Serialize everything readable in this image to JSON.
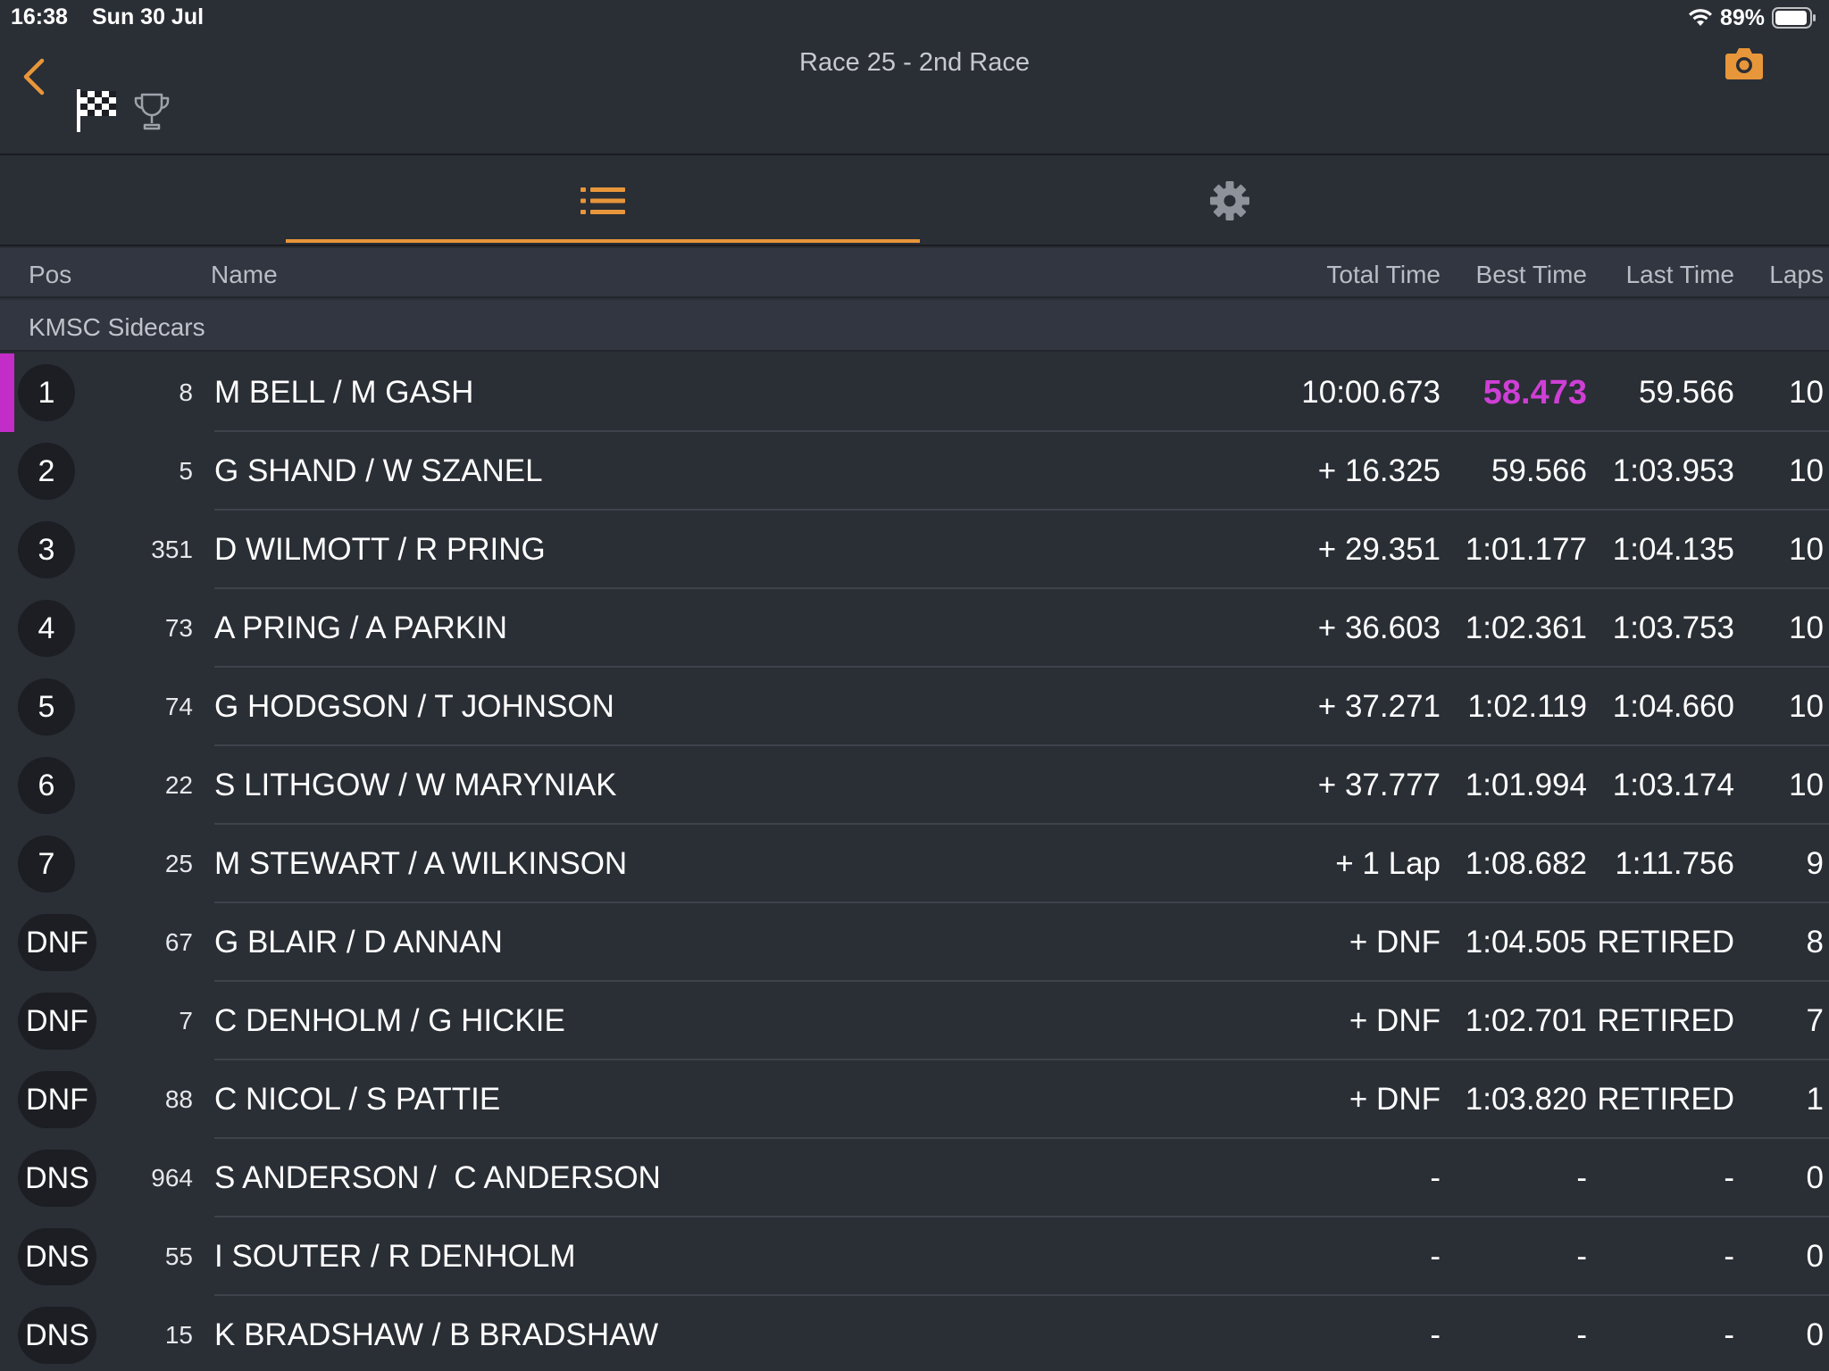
{
  "status_bar": {
    "time": "16:38",
    "date": "Sun 30 Jul",
    "battery": "89%"
  },
  "header": {
    "title": "Race 25 - 2nd Race"
  },
  "colors": {
    "accent": "#e8963a",
    "leader_highlight": "#c22dc7",
    "background": "#2a2e35"
  },
  "icons": {
    "back": "chevron-left-icon",
    "flag": "checkered-flag-icon",
    "trophy": "trophy-icon",
    "camera": "camera-icon",
    "results_tab": "list-icon",
    "settings_tab": "gear-icon"
  },
  "table": {
    "headers": {
      "pos": "Pos",
      "name": "Name",
      "total": "Total Time",
      "best": "Best Time",
      "last": "Last Time",
      "laps": "Laps"
    },
    "group": "KMSC Sidecars",
    "rows": [
      {
        "pos": "1",
        "num": "8",
        "name": "M BELL / M GASH",
        "total": "10:00.673",
        "best": "58.473",
        "last": "59.566",
        "laps": "10"
      },
      {
        "pos": "2",
        "num": "5",
        "name": "G SHAND / W SZANEL",
        "total": "+ 16.325",
        "best": "59.566",
        "last": "1:03.953",
        "laps": "10"
      },
      {
        "pos": "3",
        "num": "351",
        "name": "D WILMOTT / R PRING",
        "total": "+ 29.351",
        "best": "1:01.177",
        "last": "1:04.135",
        "laps": "10"
      },
      {
        "pos": "4",
        "num": "73",
        "name": "A PRING / A PARKIN",
        "total": "+ 36.603",
        "best": "1:02.361",
        "last": "1:03.753",
        "laps": "10"
      },
      {
        "pos": "5",
        "num": "74",
        "name": "G HODGSON / T JOHNSON",
        "total": "+ 37.271",
        "best": "1:02.119",
        "last": "1:04.660",
        "laps": "10"
      },
      {
        "pos": "6",
        "num": "22",
        "name": "S LITHGOW / W MARYNIAK",
        "total": "+ 37.777",
        "best": "1:01.994",
        "last": "1:03.174",
        "laps": "10"
      },
      {
        "pos": "7",
        "num": "25",
        "name": "M STEWART / A WILKINSON",
        "total": "+ 1 Lap",
        "best": "1:08.682",
        "last": "1:11.756",
        "laps": "9"
      },
      {
        "pos": "DNF",
        "num": "67",
        "name": "G BLAIR / D ANNAN",
        "total": "+ DNF",
        "best": "1:04.505",
        "last": "RETIRED",
        "laps": "8"
      },
      {
        "pos": "DNF",
        "num": "7",
        "name": "C DENHOLM / G HICKIE",
        "total": "+ DNF",
        "best": "1:02.701",
        "last": "RETIRED",
        "laps": "7"
      },
      {
        "pos": "DNF",
        "num": "88",
        "name": "C NICOL / S PATTIE",
        "total": "+ DNF",
        "best": "1:03.820",
        "last": "RETIRED",
        "laps": "1"
      },
      {
        "pos": "DNS",
        "num": "964",
        "name": "S ANDERSON /  C ANDERSON",
        "total": "-",
        "best": "-",
        "last": "-",
        "laps": "0"
      },
      {
        "pos": "DNS",
        "num": "55",
        "name": "I SOUTER / R DENHOLM",
        "total": "-",
        "best": "-",
        "last": "-",
        "laps": "0"
      },
      {
        "pos": "DNS",
        "num": "15",
        "name": "K BRADSHAW / B BRADSHAW",
        "total": "-",
        "best": "-",
        "last": "-",
        "laps": "0"
      }
    ]
  }
}
